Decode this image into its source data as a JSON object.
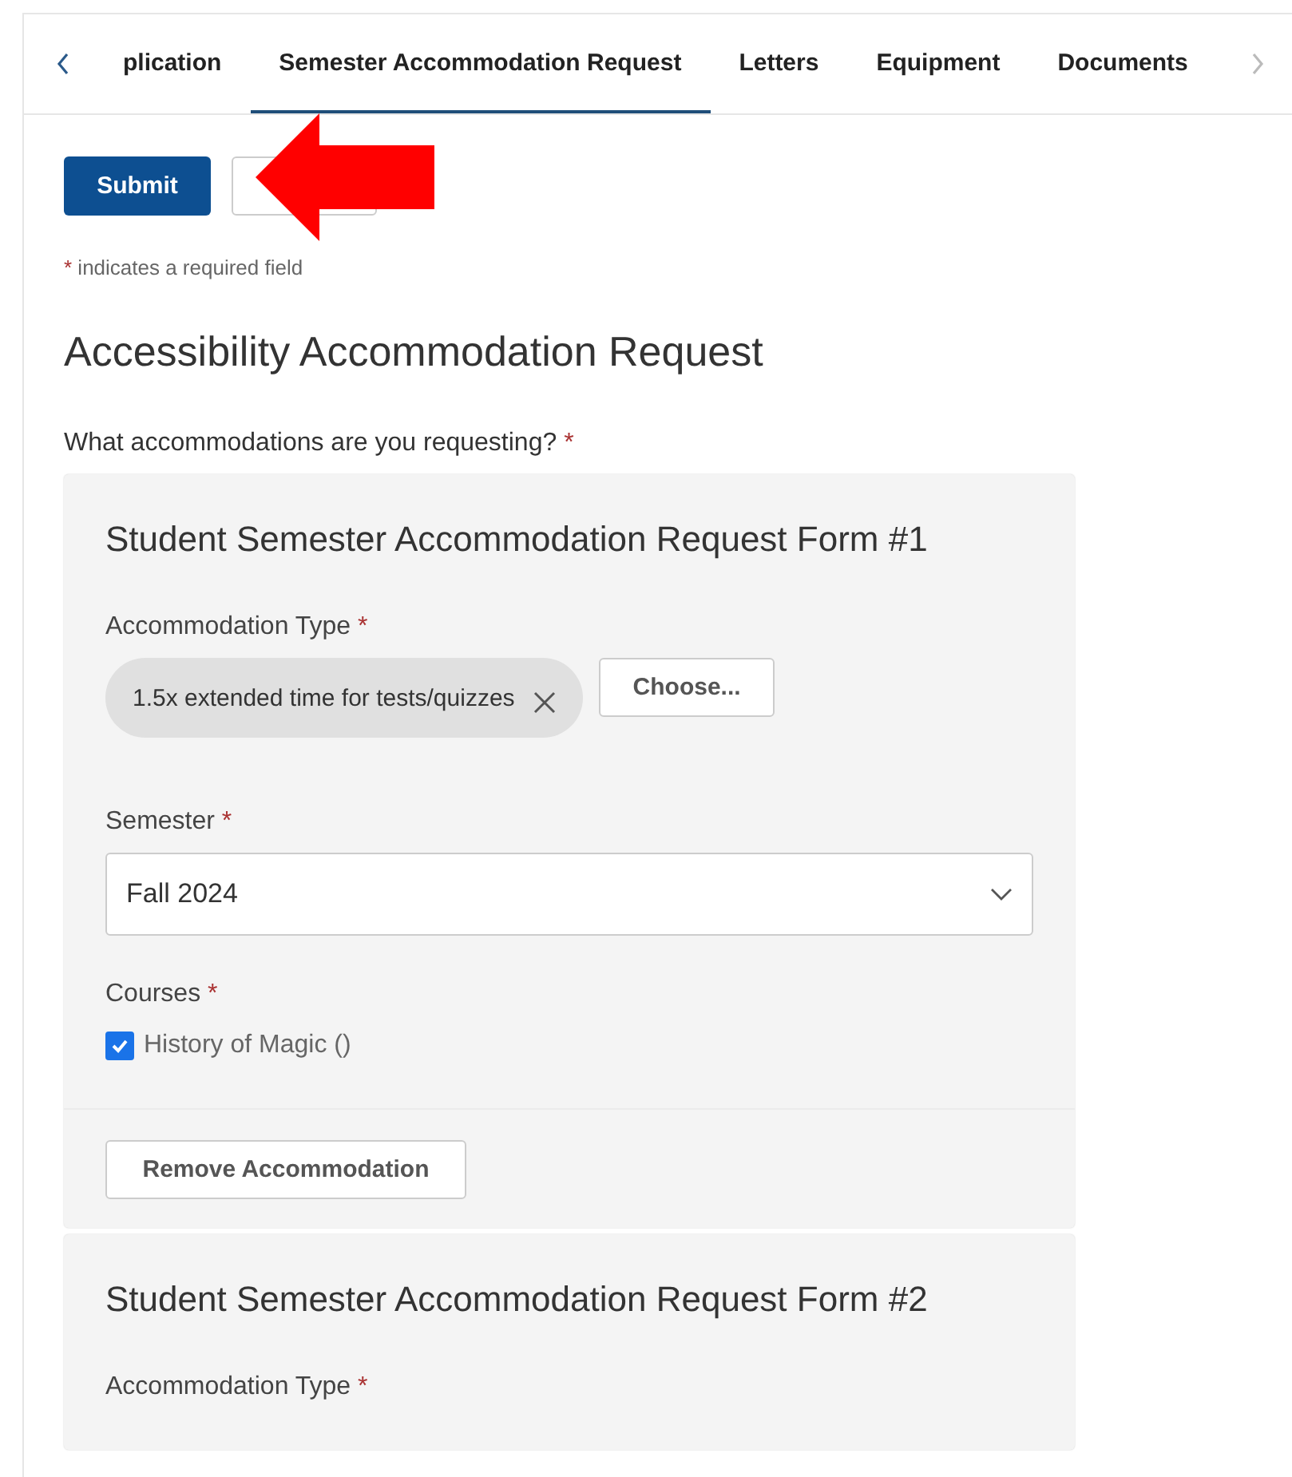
{
  "tabs": [
    {
      "label": "plication",
      "selected": false
    },
    {
      "label": "Semester Accommodation Request",
      "selected": true
    },
    {
      "label": "Letters",
      "selected": false
    },
    {
      "label": "Equipment",
      "selected": false
    },
    {
      "label": "Documents",
      "selected": false
    }
  ],
  "actions": {
    "submit": "Submit"
  },
  "required_note": {
    "mark": "*",
    "text": "indicates a required field"
  },
  "heading": "Accessibility Accommodation Request",
  "question": {
    "text": "What accommodations are you requesting?",
    "mark": "*"
  },
  "forms": [
    {
      "title": "Student Semester Accommodation Request Form #1",
      "type_label": {
        "text": "Accommodation Type",
        "mark": "*"
      },
      "chip": "1.5x extended time for tests/quizzes",
      "choose": "Choose...",
      "semester_label": {
        "text": "Semester",
        "mark": "*"
      },
      "semester": "Fall 2024",
      "courses_label": {
        "text": "Courses",
        "mark": "*"
      },
      "courses": [
        {
          "label": "History of Magic ()",
          "checked": true
        }
      ],
      "remove": "Remove Accommodation"
    },
    {
      "title": "Student Semester Accommodation Request Form #2",
      "type_label": {
        "text": "Accommodation Type",
        "mark": "*"
      }
    }
  ]
}
